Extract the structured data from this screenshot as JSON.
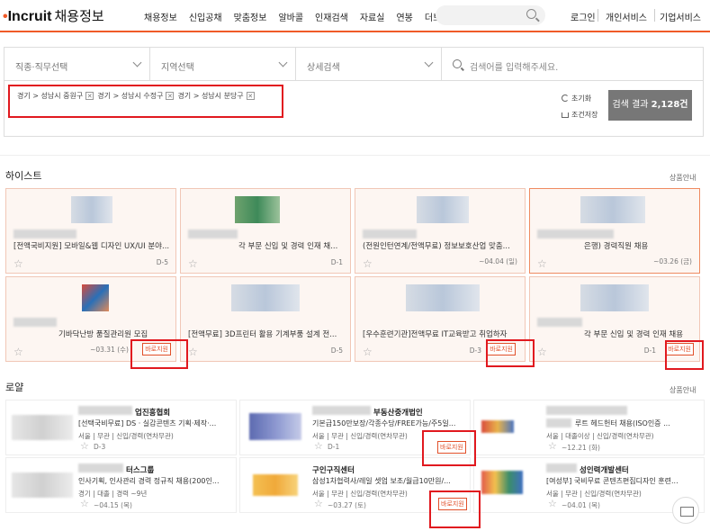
{
  "header": {
    "logo_text": "Incruit",
    "logo_sub": "채용정보",
    "nav": [
      "채용정보",
      "신입공채",
      "맞춤정보",
      "알바콜",
      "인재검색",
      "자료실",
      "연봉",
      "더보기"
    ],
    "util": [
      "로그인",
      "개인서비스",
      "기업서비스"
    ]
  },
  "filters": {
    "job": "직종·직무선택",
    "region": "지역선택",
    "detail": "상세검색",
    "search_placeholder": "검색어를 입력해주세요."
  },
  "selected_tags": [
    "경기 > 성남시 중원구",
    "경기 > 성남시 수정구",
    "경기 > 성남시 분당구"
  ],
  "actions": {
    "reset": "초기화",
    "save": "조건저장"
  },
  "result": {
    "label": "검색 결과",
    "count": "2,128건"
  },
  "highlight": {
    "title": "하이스트",
    "more": "상품안내",
    "cards": [
      {
        "title": "[전액국비지원] 모바일&웹 디자인 UX/UI 분야...",
        "date": "D-5",
        "apply": ""
      },
      {
        "title": "각 부문 신입 및 경력 인재 채...",
        "date": "D-1",
        "apply": ""
      },
      {
        "title": "(전원인턴연계/전액무료) 정보보호산업 맞춤...",
        "date": "~04.04 (일)",
        "apply": ""
      },
      {
        "title": "은행) 경력직원 채용",
        "date": "~03.26 (금)",
        "apply": ""
      },
      {
        "title": "기바닥난방 품질관리원 모집",
        "date": "~03.31 (수)",
        "apply": "바로지원"
      },
      {
        "title": "[전액무료] 3D프린터 활용 기계부품 설계 전...",
        "date": "D-5",
        "apply": ""
      },
      {
        "title": "[우수훈련기관]전액무료 IT교육받고 취업하자",
        "date": "D-3",
        "apply": "바로지원"
      },
      {
        "title": "각 부문 신입 및 경력 인재 채용",
        "date": "D-1",
        "apply": "바로지원"
      }
    ]
  },
  "royal": {
    "title": "로얄",
    "more": "상품안내",
    "cards": [
      {
        "name": "업진흥협회",
        "desc": "[선택국비무료] DS · 실감콘텐츠 기획·제작·...",
        "meta": "서울 | 무관 | 신입/경력(연차무관)",
        "date": "D-3",
        "apply": ""
      },
      {
        "name": "부동산중개법인",
        "desc": "기본급150만보장/각종수당/FREE가능/주5일...",
        "meta": "서울 | 무관 | 신입/경력(연차무관)",
        "date": "D-1",
        "apply": "바로지원"
      },
      {
        "name": "",
        "desc": "루트 헤드헌터 채용(ISO인증 ...",
        "meta": "서울 | 대졸이상 | 신입/경력(연차무관)",
        "date": "~12.21 (화)",
        "apply": ""
      },
      {
        "name": "터스그룹",
        "desc": "인사기획, 인사관리 경력 정규직 채용(200인...",
        "meta": "경기 | 대졸 | 경력 ~9년",
        "date": "~04.15 (목)",
        "apply": ""
      },
      {
        "name": "구인구직센터",
        "desc": "삼성1차협력사/레일 셋업 보조/월급10만원/...",
        "meta": "서울 | 무관 | 신입/경력(연차무관)",
        "date": "~03.27 (토)",
        "apply": "바로지원"
      },
      {
        "name": "성인력개발센터",
        "desc": "[여성부] 국비무료 콘텐츠편집디자인 훈련...",
        "meta": "서울 | 무관 | 신입/경력(연차무관)",
        "date": "~04.01 (목)",
        "apply": ""
      }
    ]
  }
}
